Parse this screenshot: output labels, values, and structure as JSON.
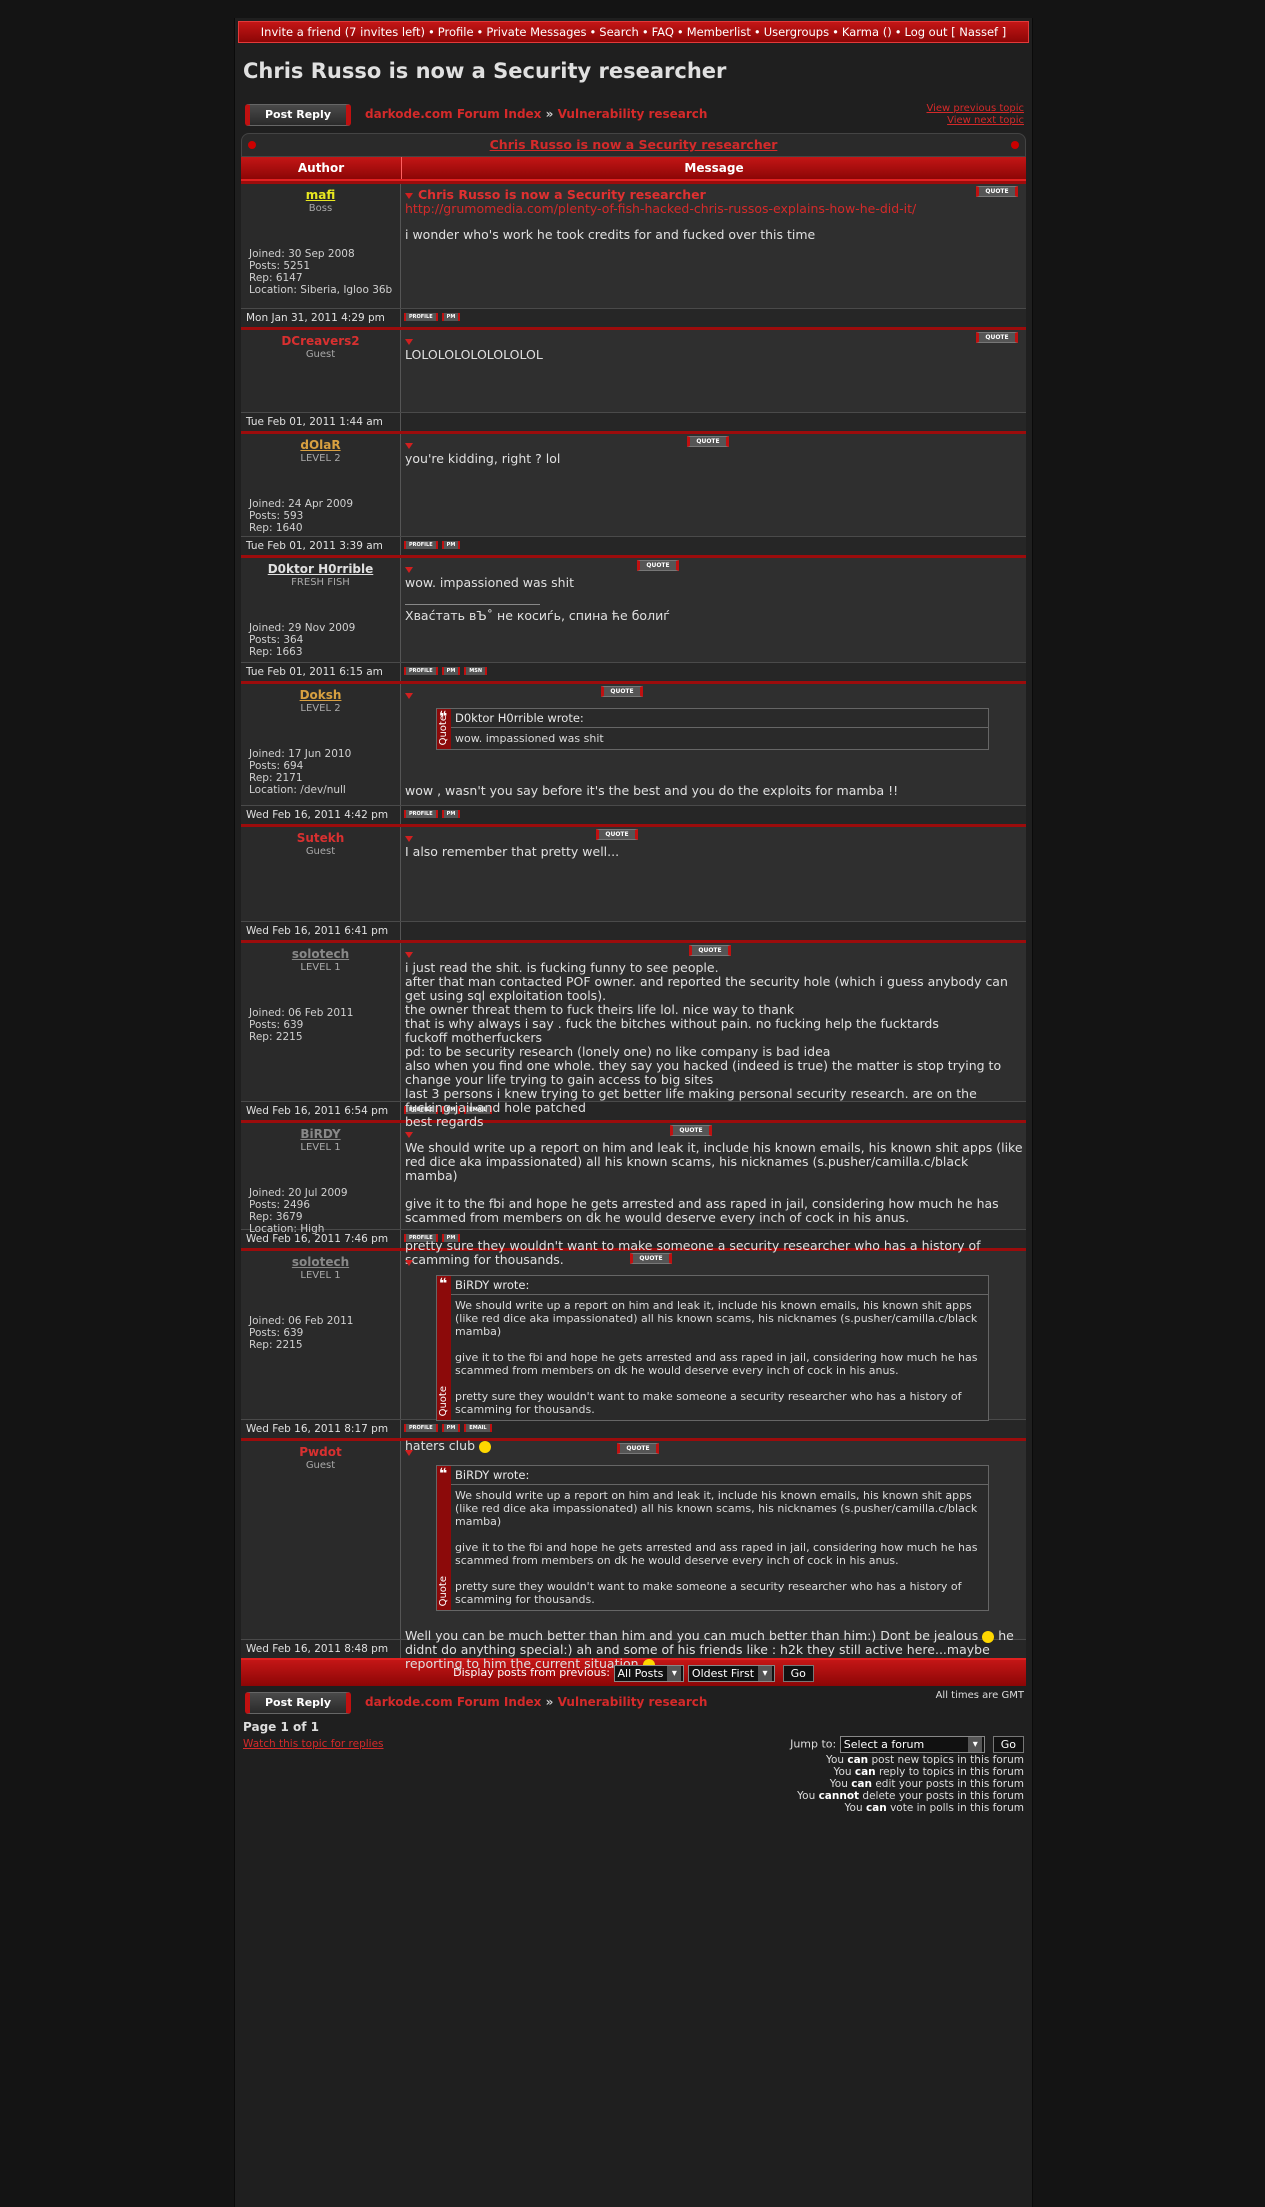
{
  "topnav": {
    "items": [
      "Invite a friend (7 invites left)",
      "Profile",
      "Private Messages",
      "Search",
      "FAQ",
      "Memberlist",
      "Usergroups",
      "Karma ()",
      "Log out [ Nassef ]"
    ],
    "separator": "•"
  },
  "page_title": "Chris Russo is now a Security researcher",
  "post_reply_label": "Post Reply",
  "breadcrumb": {
    "forum_index": "darkode.com Forum Index",
    "arrow": "»",
    "subforum": "Vulnerability research"
  },
  "prev_topic": "View previous topic",
  "next_topic": "View next topic",
  "thread_title": "Chris Russo is now a Security researcher",
  "columns": {
    "author": "Author",
    "message": "Message"
  },
  "buttons": {
    "quote": "QUOTE",
    "profile": "PROFILE",
    "pm": "PM",
    "msn": "MSN",
    "email": "EMAIL"
  },
  "colors": {
    "accent_red": "#d42a2a",
    "name_yellow": "#e8e820",
    "name_orange": "#d8a040",
    "name_gray": "#888888",
    "name_red": "#d83030",
    "name_white": "#e0e0e0"
  },
  "posts": [
    {
      "author": "mafi",
      "name_style": "yellow",
      "rank": "Boss",
      "stats": [
        "Joined: 30 Sep 2008",
        "Posts: 5251",
        "Rep: 6147",
        "Location: Siberia, Igloo 36b"
      ],
      "subject": "Chris Russo is now a Security researcher",
      "link": "http://grumomedia.com/plenty-of-fish-hacked-chris-russos-explains-how-he-did-it/",
      "text": "i wonder who's work he took credits for and fucked over this time",
      "date": "Mon Jan 31, 2011 4:29 pm",
      "foot_buttons": [
        "profile",
        "pm"
      ]
    },
    {
      "author": "DCreavers2",
      "name_style": "red",
      "rank": "Guest",
      "stats": [],
      "subject": "",
      "text": "LOLOLOLOLOLOLOLOL",
      "date": "Tue Feb 01, 2011 1:44 am",
      "foot_buttons": []
    },
    {
      "author": "dOlaR",
      "name_style": "orange",
      "rank": "LEVEL 2",
      "stats": [
        "Joined: 24 Apr 2009",
        "Posts: 593",
        "Rep: 1640"
      ],
      "subject": "",
      "text": "you're kidding, right ? lol",
      "date": "Tue Feb 01, 2011 3:39 am",
      "foot_buttons": [
        "profile",
        "pm"
      ]
    },
    {
      "author": "D0ktor H0rrible",
      "name_style": "white",
      "rank": "FRESH FISH",
      "stats": [
        "Joined: 29 Nov 2009",
        "Posts: 364",
        "Rep: 1663"
      ],
      "subject": "",
      "text": "wow. impassioned was shit",
      "signature": "Хваćтать вЪ˚ не косиѓь, спина ће болиѓ",
      "date": "Tue Feb 01, 2011 6:15 am",
      "foot_buttons": [
        "profile",
        "pm",
        "msn"
      ]
    },
    {
      "author": "Doksh",
      "name_style": "orange",
      "rank": "LEVEL 2",
      "stats": [
        "Joined: 17 Jun 2010",
        "Posts: 694",
        "Rep: 2171",
        "Location: /dev/null"
      ],
      "subject": "",
      "quote": {
        "head": "D0ktor H0rrible wrote:",
        "lines": [
          "wow. impassioned was shit"
        ]
      },
      "text": "wow , wasn't you say before it's the best and you do the exploits for mamba !!",
      "date": "Wed Feb 16, 2011 4:42 pm",
      "foot_buttons": [
        "profile",
        "pm"
      ]
    },
    {
      "author": "Sutekh",
      "name_style": "red",
      "rank": "Guest",
      "stats": [],
      "subject": "",
      "text": "I also remember that pretty well...",
      "date": "Wed Feb 16, 2011 6:41 pm",
      "foot_buttons": []
    },
    {
      "author": "solotech",
      "name_style": "gray",
      "rank": "LEVEL 1",
      "stats": [
        "Joined: 06 Feb 2011",
        "Posts: 639",
        "Rep: 2215"
      ],
      "subject": "",
      "lines": [
        "i just read the shit. is fucking funny to see people.",
        "after that man contacted POF owner. and reported the security hole (which i guess anybody can get using sql exploitation tools).",
        "the owner threat them to fuck theirs life lol. nice way to thank",
        "that is why always i say . fuck the bitches without pain. no fucking help the fucktards",
        "fuckoff motherfuckers",
        "pd: to be security research (lonely one) no like company is bad idea",
        "also when you find one whole. they say you hacked (indeed is true) the matter is stop trying to change your life trying to gain access to big sites",
        "last 3 persons i knew trying to get better life making personal security research. are on the fucking jail and hole patched",
        "best regards"
      ],
      "date": "Wed Feb 16, 2011 6:54 pm",
      "foot_buttons": [
        "profile",
        "pm",
        "email"
      ]
    },
    {
      "author": "BiRDY",
      "name_style": "gray",
      "rank": "LEVEL 1",
      "stats": [
        "Joined: 20 Jul 2009",
        "Posts: 2496",
        "Rep: 3679",
        "Location: High"
      ],
      "subject": "",
      "paragraphs": [
        "We should write up a report on him and leak it, include his known emails, his known shit apps (like red dice aka impassionated) all his known scams, his nicknames (s.pusher/camilla.c/black mamba)",
        "give it to the fbi and hope he gets arrested and ass raped in jail, considering how much he has scammed from members on dk he would deserve every inch of cock in his anus.",
        "pretty sure they wouldn't want to make someone a security researcher who has a history of scamming for thousands."
      ],
      "date": "Wed Feb 16, 2011 7:46 pm",
      "foot_buttons": [
        "profile",
        "pm"
      ]
    },
    {
      "author": "solotech",
      "name_style": "gray",
      "rank": "LEVEL 1",
      "stats": [
        "Joined: 06 Feb 2011",
        "Posts: 639",
        "Rep: 2215"
      ],
      "subject": "",
      "quote": {
        "head": "BiRDY wrote:",
        "lines": [
          "We should write up a report on him and leak it, include his known emails, his known shit apps (like red dice aka impassionated) all his known scams, his nicknames (s.pusher/camilla.c/black mamba)",
          "give it to the fbi and hope he gets arrested and ass raped in jail, considering how much he has scammed from members on dk he would deserve every inch of cock in his anus.",
          "pretty sure they wouldn't want to make someone a security researcher who has a history of scamming for thousands."
        ]
      },
      "text": "haters club",
      "date": "Wed Feb 16, 2011 8:17 pm",
      "foot_buttons": [
        "profile",
        "pm",
        "email"
      ]
    },
    {
      "author": "Pwdot",
      "name_style": "red",
      "rank": "Guest",
      "stats": [],
      "subject": "",
      "quote": {
        "head": "BiRDY wrote:",
        "lines": [
          "We should write up a report on him and leak it, include his known emails, his known shit apps (like red dice aka impassionated) all his known scams, his nicknames (s.pusher/camilla.c/black mamba)",
          "give it to the fbi and hope he gets arrested and ass raped in jail, considering how much he has scammed from members on dk he would deserve every inch of cock in his anus.",
          "pretty sure they wouldn't want to make someone a security researcher who has a history of scamming for thousands."
        ]
      },
      "text_parts": [
        "Well you can be much better than him and you can much better than him:) Dont be jealous",
        "he didnt do anything special:) ah and some of his friends like : h2k they still active here...maybe reporting to him the current situation"
      ],
      "date": "Wed Feb 16, 2011 8:48 pm",
      "foot_buttons": []
    }
  ],
  "display_bar": {
    "label": "Display posts from previous:",
    "filter": "All Posts",
    "order": "Oldest First",
    "go": "Go"
  },
  "footer": {
    "all_times": "All times are GMT",
    "page": "Page 1 of 1",
    "watch": "Watch this topic for replies",
    "jump_label": "Jump to:",
    "jump_select": "Select a forum",
    "jump_go": "Go",
    "permissions": [
      {
        "pre": "You ",
        "verb": "can",
        "post": " post new topics in this forum"
      },
      {
        "pre": "You ",
        "verb": "can",
        "post": " reply to topics in this forum"
      },
      {
        "pre": "You ",
        "verb": "can",
        "post": " edit your posts in this forum"
      },
      {
        "pre": "You ",
        "verb": "cannot",
        "post": " delete your posts in this forum"
      },
      {
        "pre": "You ",
        "verb": "can",
        "post": " vote in polls in this forum"
      }
    ]
  }
}
